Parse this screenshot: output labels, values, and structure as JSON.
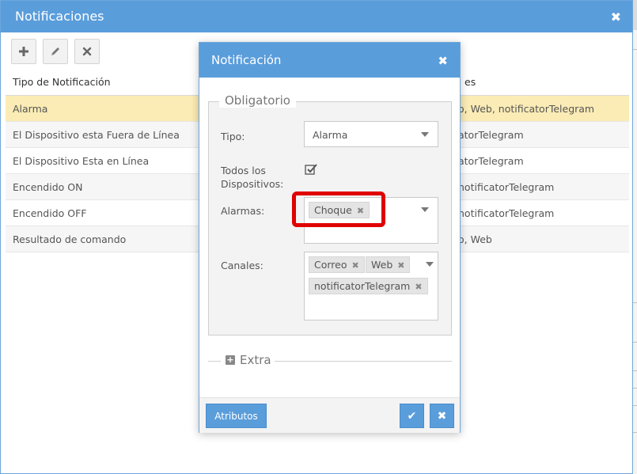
{
  "window": {
    "title": "Notificaciones",
    "close_glyph": "✖"
  },
  "toolbar": {
    "add_icon": "plus-icon",
    "edit_icon": "pencil-icon",
    "delete_icon": "x-icon"
  },
  "grid": {
    "headers": [
      "Tipo de Notificación",
      "es"
    ],
    "rows": [
      {
        "tipo": "Alarma",
        "canales": "o, Web, notificatorTelegram"
      },
      {
        "tipo": "El Dispositivo esta Fuera de Línea",
        "canales": "atorTelegram"
      },
      {
        "tipo": "El Dispositivo Esta en Línea",
        "canales": "atorTelegram"
      },
      {
        "tipo": "Encendido ON",
        "canales": "notificatorTelegram"
      },
      {
        "tipo": "Encendido OFF",
        "canales": "notificatorTelegram"
      },
      {
        "tipo": "Resultado de comando",
        "canales": "o, Web"
      }
    ]
  },
  "modal": {
    "title": "Notificación",
    "close_glyph": "✖",
    "section_required": "Obligatorio",
    "tipo_label": "Tipo:",
    "tipo_value": "Alarma",
    "todos_label": "Todos los Dispositivos:",
    "todos_checked": true,
    "alarmas_label": "Alarmas:",
    "alarmas": [
      "Choque"
    ],
    "canales_label": "Canales:",
    "canales": [
      "Correo",
      "Web",
      "notificatorTelegram"
    ],
    "chip_remove_glyph": "✖",
    "extra_label": "Extra",
    "attributes_button": "Atributos",
    "ok_glyph": "✔",
    "cancel_glyph": "✖"
  },
  "colors": {
    "header_blue": "#5a9ddb",
    "selected_row": "#fbecb5",
    "highlight_red": "#e00000"
  }
}
